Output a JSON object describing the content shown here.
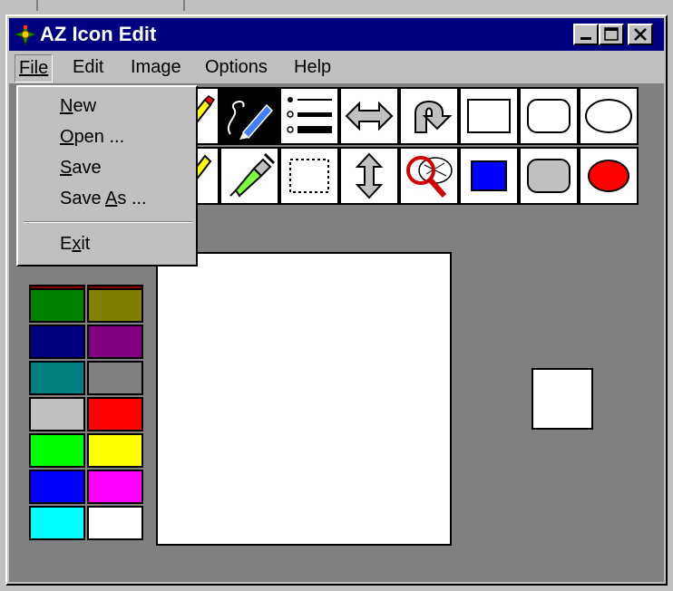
{
  "window": {
    "title": "AZ Icon Edit"
  },
  "menubar": {
    "items": [
      {
        "label": "File"
      },
      {
        "label": "Edit"
      },
      {
        "label": "Image"
      },
      {
        "label": "Options"
      },
      {
        "label": "Help"
      }
    ]
  },
  "file_menu": {
    "open": true,
    "items": [
      {
        "label": "New"
      },
      {
        "label": "Open ..."
      },
      {
        "label": "Save"
      },
      {
        "label": "Save As ..."
      },
      {
        "label": "Exit"
      }
    ]
  },
  "toolbar": {
    "row1": [
      "pencil-icon",
      "freehand-curve-icon",
      "brush-width-icon",
      "flip-horizontal-icon",
      "rotate-icon",
      "rectangle-outline-icon",
      "rounded-rectangle-outline-icon",
      "ellipse-outline-icon"
    ],
    "row2": [
      "line-icon",
      "eyedropper-icon",
      "selection-rectangle-icon",
      "flip-vertical-icon",
      "zoom-icon",
      "filled-rectangle-icon",
      "filled-rounded-rectangle-icon",
      "filled-ellipse-icon"
    ],
    "selected": "freehand-curve-icon"
  },
  "palette": {
    "colors": [
      "#008000",
      "#808000",
      "#000080",
      "#800080",
      "#008080",
      "#808080",
      "#c0c0c0",
      "#ff0000",
      "#00ff00",
      "#ffff00",
      "#0000ff",
      "#ff00ff",
      "#00ffff",
      "#ffffff"
    ]
  },
  "colors": {
    "titlebar": "#000080",
    "workspace": "#808080",
    "chrome": "#c0c0c0"
  }
}
